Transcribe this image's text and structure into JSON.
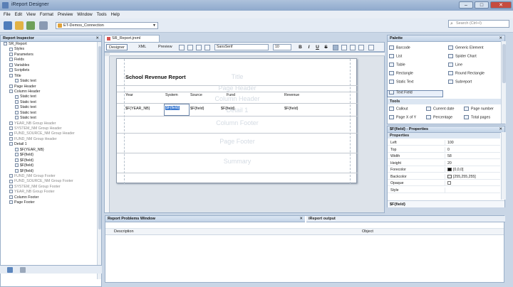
{
  "window": {
    "title": "iReport Designer",
    "minimize": "–",
    "maximize": "□",
    "close": "✕"
  },
  "menu": [
    "File",
    "Edit",
    "View",
    "Format",
    "Preview",
    "Window",
    "Tools",
    "Help"
  ],
  "toolbar": {
    "connection": "ET-Demos_Connection",
    "search_placeholder": "Search (Ctrl+I)"
  },
  "inspector": {
    "title": "Report Inspector",
    "items": [
      {
        "label": "SR_Report",
        "indent": 0
      },
      {
        "label": "Styles",
        "indent": 1
      },
      {
        "label": "Parameters",
        "indent": 1
      },
      {
        "label": "Fields",
        "indent": 1
      },
      {
        "label": "Variables",
        "indent": 1
      },
      {
        "label": "Scriptlets",
        "indent": 1
      },
      {
        "label": "Title",
        "indent": 1
      },
      {
        "label": "Static text",
        "indent": 2
      },
      {
        "label": "Page Header",
        "indent": 1
      },
      {
        "label": "Column Header",
        "indent": 1
      },
      {
        "label": "Static text",
        "indent": 2
      },
      {
        "label": "Static text",
        "indent": 2
      },
      {
        "label": "Static text",
        "indent": 2
      },
      {
        "label": "Static text",
        "indent": 2
      },
      {
        "label": "Static text",
        "indent": 2
      },
      {
        "label": "YEAR_NB Group Header",
        "indent": 1,
        "gray": true
      },
      {
        "label": "SYSTEM_NM Group Header",
        "indent": 1,
        "gray": true
      },
      {
        "label": "FUND_SOURCE_NM Group Header",
        "indent": 1,
        "gray": true
      },
      {
        "label": "FUND_NM Group Header",
        "indent": 1,
        "gray": true
      },
      {
        "label": "Detail 1",
        "indent": 1
      },
      {
        "label": "$F{YEAR_NB}",
        "indent": 2
      },
      {
        "label": "$F{field}",
        "indent": 2
      },
      {
        "label": "$F{field}",
        "indent": 2
      },
      {
        "label": "$F{field}",
        "indent": 2
      },
      {
        "label": "$F{field}",
        "indent": 2
      },
      {
        "label": "FUND_NM Group Footer",
        "indent": 1,
        "gray": true
      },
      {
        "label": "FUND_SOURCE_NM Group Footer",
        "indent": 1,
        "gray": true
      },
      {
        "label": "SYSTEM_NM Group Footer",
        "indent": 1,
        "gray": true
      },
      {
        "label": "YEAR_NB Group Footer",
        "indent": 1,
        "gray": true
      },
      {
        "label": "Column Footer",
        "indent": 1
      },
      {
        "label": "Page Footer",
        "indent": 1
      }
    ]
  },
  "document": {
    "tab": "SR_Report.jrxml",
    "views": [
      "Designer",
      "XML",
      "Preview"
    ],
    "font": "SansSerif",
    "size": "10"
  },
  "report": {
    "title": "School Revenue Report",
    "bands": [
      "Title",
      "Page Header",
      "Column Header",
      "Detail 1",
      "Column Footer",
      "Page Footer",
      "Summary"
    ],
    "columns": [
      "Year",
      "System",
      "Source",
      "Fund",
      "Revenue"
    ],
    "fields": [
      "$F{YEAR_NB}",
      "$F{field}",
      "$F{field}",
      "$F{field}",
      "$F{field}"
    ]
  },
  "palette": {
    "title": "Palette",
    "elements": [
      [
        "Barcode",
        "Generic Element"
      ],
      [
        "List",
        "Spider Chart"
      ],
      [
        "Table",
        "Line"
      ],
      [
        "Rectangle",
        "Round Rectangle"
      ],
      [
        "Static Text",
        "Subreport"
      ],
      [
        "Text Field",
        ""
      ]
    ],
    "tools_title": "Tools",
    "tools": [
      [
        "Callout",
        "Current date",
        "Page number"
      ],
      [
        "Page X of Y",
        "Percentage",
        "Total pages"
      ]
    ]
  },
  "properties": {
    "title": "$F{field} - Properties",
    "section": "Properties",
    "rows": [
      {
        "name": "Left",
        "value": "100"
      },
      {
        "name": "Top",
        "value": "0"
      },
      {
        "name": "Width",
        "value": "58"
      },
      {
        "name": "Height",
        "value": "20"
      },
      {
        "name": "Forecolor",
        "value": "[0,0,0]",
        "swatch": "#000000"
      },
      {
        "name": "Backcolor",
        "value": "[255,255,255]",
        "swatch": "#ffffff"
      },
      {
        "name": "Opaque",
        "value": "",
        "checkbox": true
      },
      {
        "name": "Style",
        "value": ""
      }
    ],
    "footer": "$F{field}"
  },
  "problems": {
    "title": "Report Problems Window",
    "output_tab": "iReport output",
    "columns": [
      "Description",
      "Object"
    ]
  }
}
